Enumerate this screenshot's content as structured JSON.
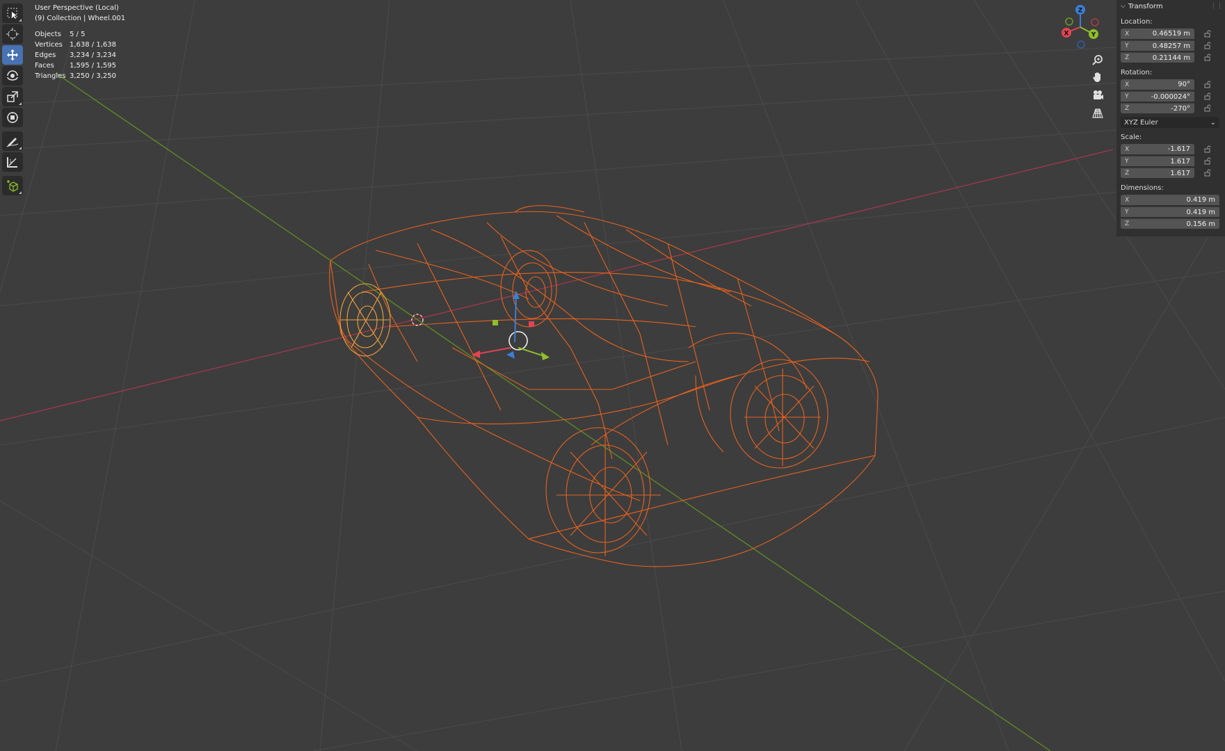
{
  "viewport": {
    "view_name": "User Perspective (Local)",
    "collection_line": "(9) Collection | Wheel.001",
    "stats": [
      {
        "label": "Objects",
        "value": "5 / 5"
      },
      {
        "label": "Vertices",
        "value": "1,638 / 1,638"
      },
      {
        "label": "Edges",
        "value": "3,234 / 3,234"
      },
      {
        "label": "Faces",
        "value": "1,595 / 1,595"
      },
      {
        "label": "Triangles",
        "value": "3,250 / 3,250"
      }
    ],
    "wire_color": "#e8621e",
    "grid_color": "#4a4a4a",
    "x_axis_color": "#b23b45",
    "y_axis_color": "#6a9a25"
  },
  "toolbar": {
    "tools": [
      {
        "name": "select-box",
        "icon": "select-box-icon",
        "active": false
      },
      {
        "name": "cursor",
        "icon": "cursor-icon",
        "active": false
      },
      {
        "name": "move",
        "icon": "move-icon",
        "active": true
      },
      {
        "name": "rotate",
        "icon": "rotate-icon",
        "active": false
      },
      {
        "name": "scale",
        "icon": "scale-icon",
        "active": false
      },
      {
        "name": "transform",
        "icon": "transform-icon",
        "active": false
      },
      {
        "name": "annotate",
        "icon": "annotate-icon",
        "active": false
      },
      {
        "name": "measure",
        "icon": "measure-icon",
        "active": false
      },
      {
        "name": "add-cube",
        "icon": "add-cube-icon",
        "active": false
      }
    ]
  },
  "gizmo": {
    "labels": {
      "z": "Z",
      "x": "X",
      "y": "Y"
    },
    "colors": {
      "x": "#e24452",
      "y": "#8fbf2a",
      "z": "#3b7ed6"
    }
  },
  "nav_buttons": [
    "zoom-icon",
    "hand-pan-icon",
    "camera-icon",
    "perspective-grid-icon"
  ],
  "npanel": {
    "header": "Transform",
    "location": {
      "label": "Location:",
      "x": "0.46519 m",
      "y": "0.48257 m",
      "z": "0.21144 m"
    },
    "rotation": {
      "label": "Rotation:",
      "x": "90°",
      "y": "-0.000024°",
      "z": "-270°",
      "mode": "XYZ Euler"
    },
    "scale": {
      "label": "Scale:",
      "x": "-1.617",
      "y": "1.617",
      "z": "1.617"
    },
    "dimensions": {
      "label": "Dimensions:",
      "x": "0.419 m",
      "y": "0.419 m",
      "z": "0.156 m"
    },
    "axis_labels": {
      "x": "X",
      "y": "Y",
      "z": "Z"
    }
  }
}
